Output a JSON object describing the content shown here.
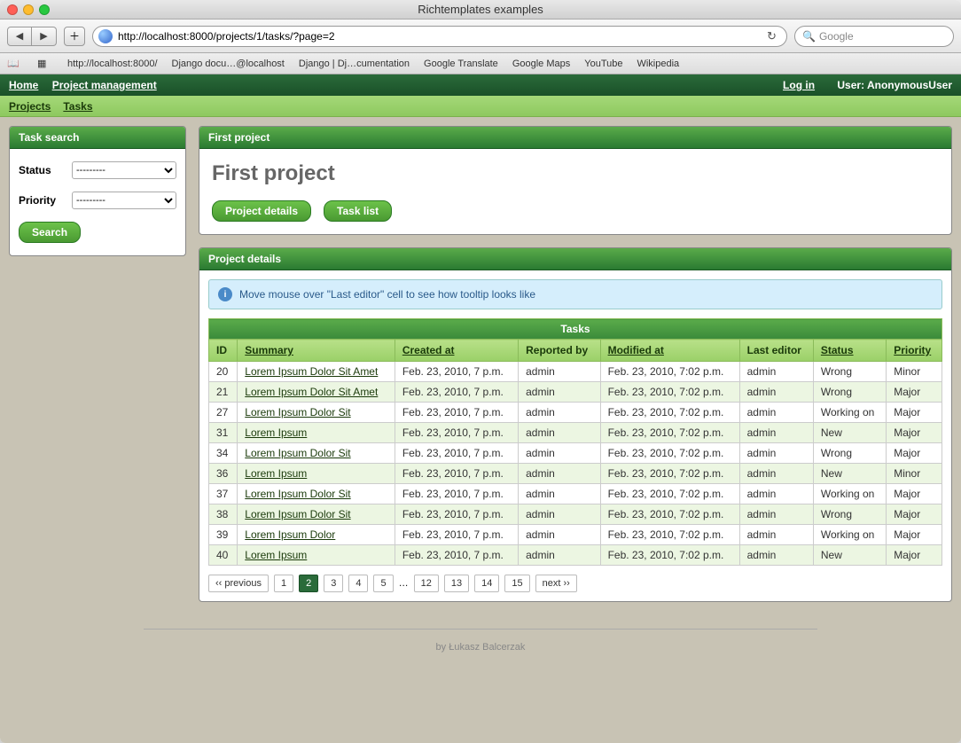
{
  "window": {
    "title": "Richtemplates examples"
  },
  "browser": {
    "url": "http://localhost:8000/projects/1/tasks/?page=2",
    "search_placeholder": "Google",
    "bookmarks": [
      "http://localhost:8000/",
      "Django docu…@localhost",
      "Django | Dj…cumentation",
      "Google Translate",
      "Google Maps",
      "YouTube",
      "Wikipedia"
    ]
  },
  "topnav": {
    "left": [
      "Home",
      "Project management"
    ],
    "login": "Log in",
    "user_label": "User:",
    "username": "AnonymousUser"
  },
  "subnav": [
    "Projects",
    "Tasks"
  ],
  "sidebar": {
    "title": "Task search",
    "status_label": "Status",
    "priority_label": "Priority",
    "placeholder": "---------",
    "search_btn": "Search"
  },
  "project": {
    "panel_title": "First project",
    "heading": "First project",
    "btn_details": "Project details",
    "btn_tasklist": "Task list"
  },
  "details": {
    "panel_title": "Project details",
    "info": "Move mouse over \"Last editor\" cell to see how tooltip looks like",
    "table_caption": "Tasks",
    "columns": [
      "ID",
      "Summary",
      "Created at",
      "Reported by",
      "Modified at",
      "Last editor",
      "Status",
      "Priority"
    ],
    "rows": [
      {
        "id": "20",
        "summary": "Lorem Ipsum Dolor Sit Amet",
        "created": "Feb. 23, 2010, 7 p.m.",
        "reported": "admin",
        "modified": "Feb. 23, 2010, 7:02 p.m.",
        "editor": "admin",
        "status": "Wrong",
        "priority": "Minor"
      },
      {
        "id": "21",
        "summary": "Lorem Ipsum Dolor Sit Amet",
        "created": "Feb. 23, 2010, 7 p.m.",
        "reported": "admin",
        "modified": "Feb. 23, 2010, 7:02 p.m.",
        "editor": "admin",
        "status": "Wrong",
        "priority": "Major"
      },
      {
        "id": "27",
        "summary": "Lorem Ipsum Dolor Sit",
        "created": "Feb. 23, 2010, 7 p.m.",
        "reported": "admin",
        "modified": "Feb. 23, 2010, 7:02 p.m.",
        "editor": "admin",
        "status": "Working on",
        "priority": "Major"
      },
      {
        "id": "31",
        "summary": "Lorem Ipsum",
        "created": "Feb. 23, 2010, 7 p.m.",
        "reported": "admin",
        "modified": "Feb. 23, 2010, 7:02 p.m.",
        "editor": "admin",
        "status": "New",
        "priority": "Major"
      },
      {
        "id": "34",
        "summary": "Lorem Ipsum Dolor Sit",
        "created": "Feb. 23, 2010, 7 p.m.",
        "reported": "admin",
        "modified": "Feb. 23, 2010, 7:02 p.m.",
        "editor": "admin",
        "status": "Wrong",
        "priority": "Major"
      },
      {
        "id": "36",
        "summary": "Lorem Ipsum",
        "created": "Feb. 23, 2010, 7 p.m.",
        "reported": "admin",
        "modified": "Feb. 23, 2010, 7:02 p.m.",
        "editor": "admin",
        "status": "New",
        "priority": "Minor"
      },
      {
        "id": "37",
        "summary": "Lorem Ipsum Dolor Sit",
        "created": "Feb. 23, 2010, 7 p.m.",
        "reported": "admin",
        "modified": "Feb. 23, 2010, 7:02 p.m.",
        "editor": "admin",
        "status": "Working on",
        "priority": "Major"
      },
      {
        "id": "38",
        "summary": "Lorem Ipsum Dolor Sit",
        "created": "Feb. 23, 2010, 7 p.m.",
        "reported": "admin",
        "modified": "Feb. 23, 2010, 7:02 p.m.",
        "editor": "admin",
        "status": "Wrong",
        "priority": "Major"
      },
      {
        "id": "39",
        "summary": "Lorem Ipsum Dolor",
        "created": "Feb. 23, 2010, 7 p.m.",
        "reported": "admin",
        "modified": "Feb. 23, 2010, 7:02 p.m.",
        "editor": "admin",
        "status": "Working on",
        "priority": "Major"
      },
      {
        "id": "40",
        "summary": "Lorem Ipsum",
        "created": "Feb. 23, 2010, 7 p.m.",
        "reported": "admin",
        "modified": "Feb. 23, 2010, 7:02 p.m.",
        "editor": "admin",
        "status": "New",
        "priority": "Major"
      }
    ],
    "pagination": {
      "prev": "‹‹ previous",
      "pages1": [
        "1",
        "2",
        "3",
        "4",
        "5"
      ],
      "dots": "…",
      "pages2": [
        "12",
        "13",
        "14",
        "15"
      ],
      "next": "next ››",
      "current": "2"
    }
  },
  "footer": "by Łukasz Balcerzak"
}
